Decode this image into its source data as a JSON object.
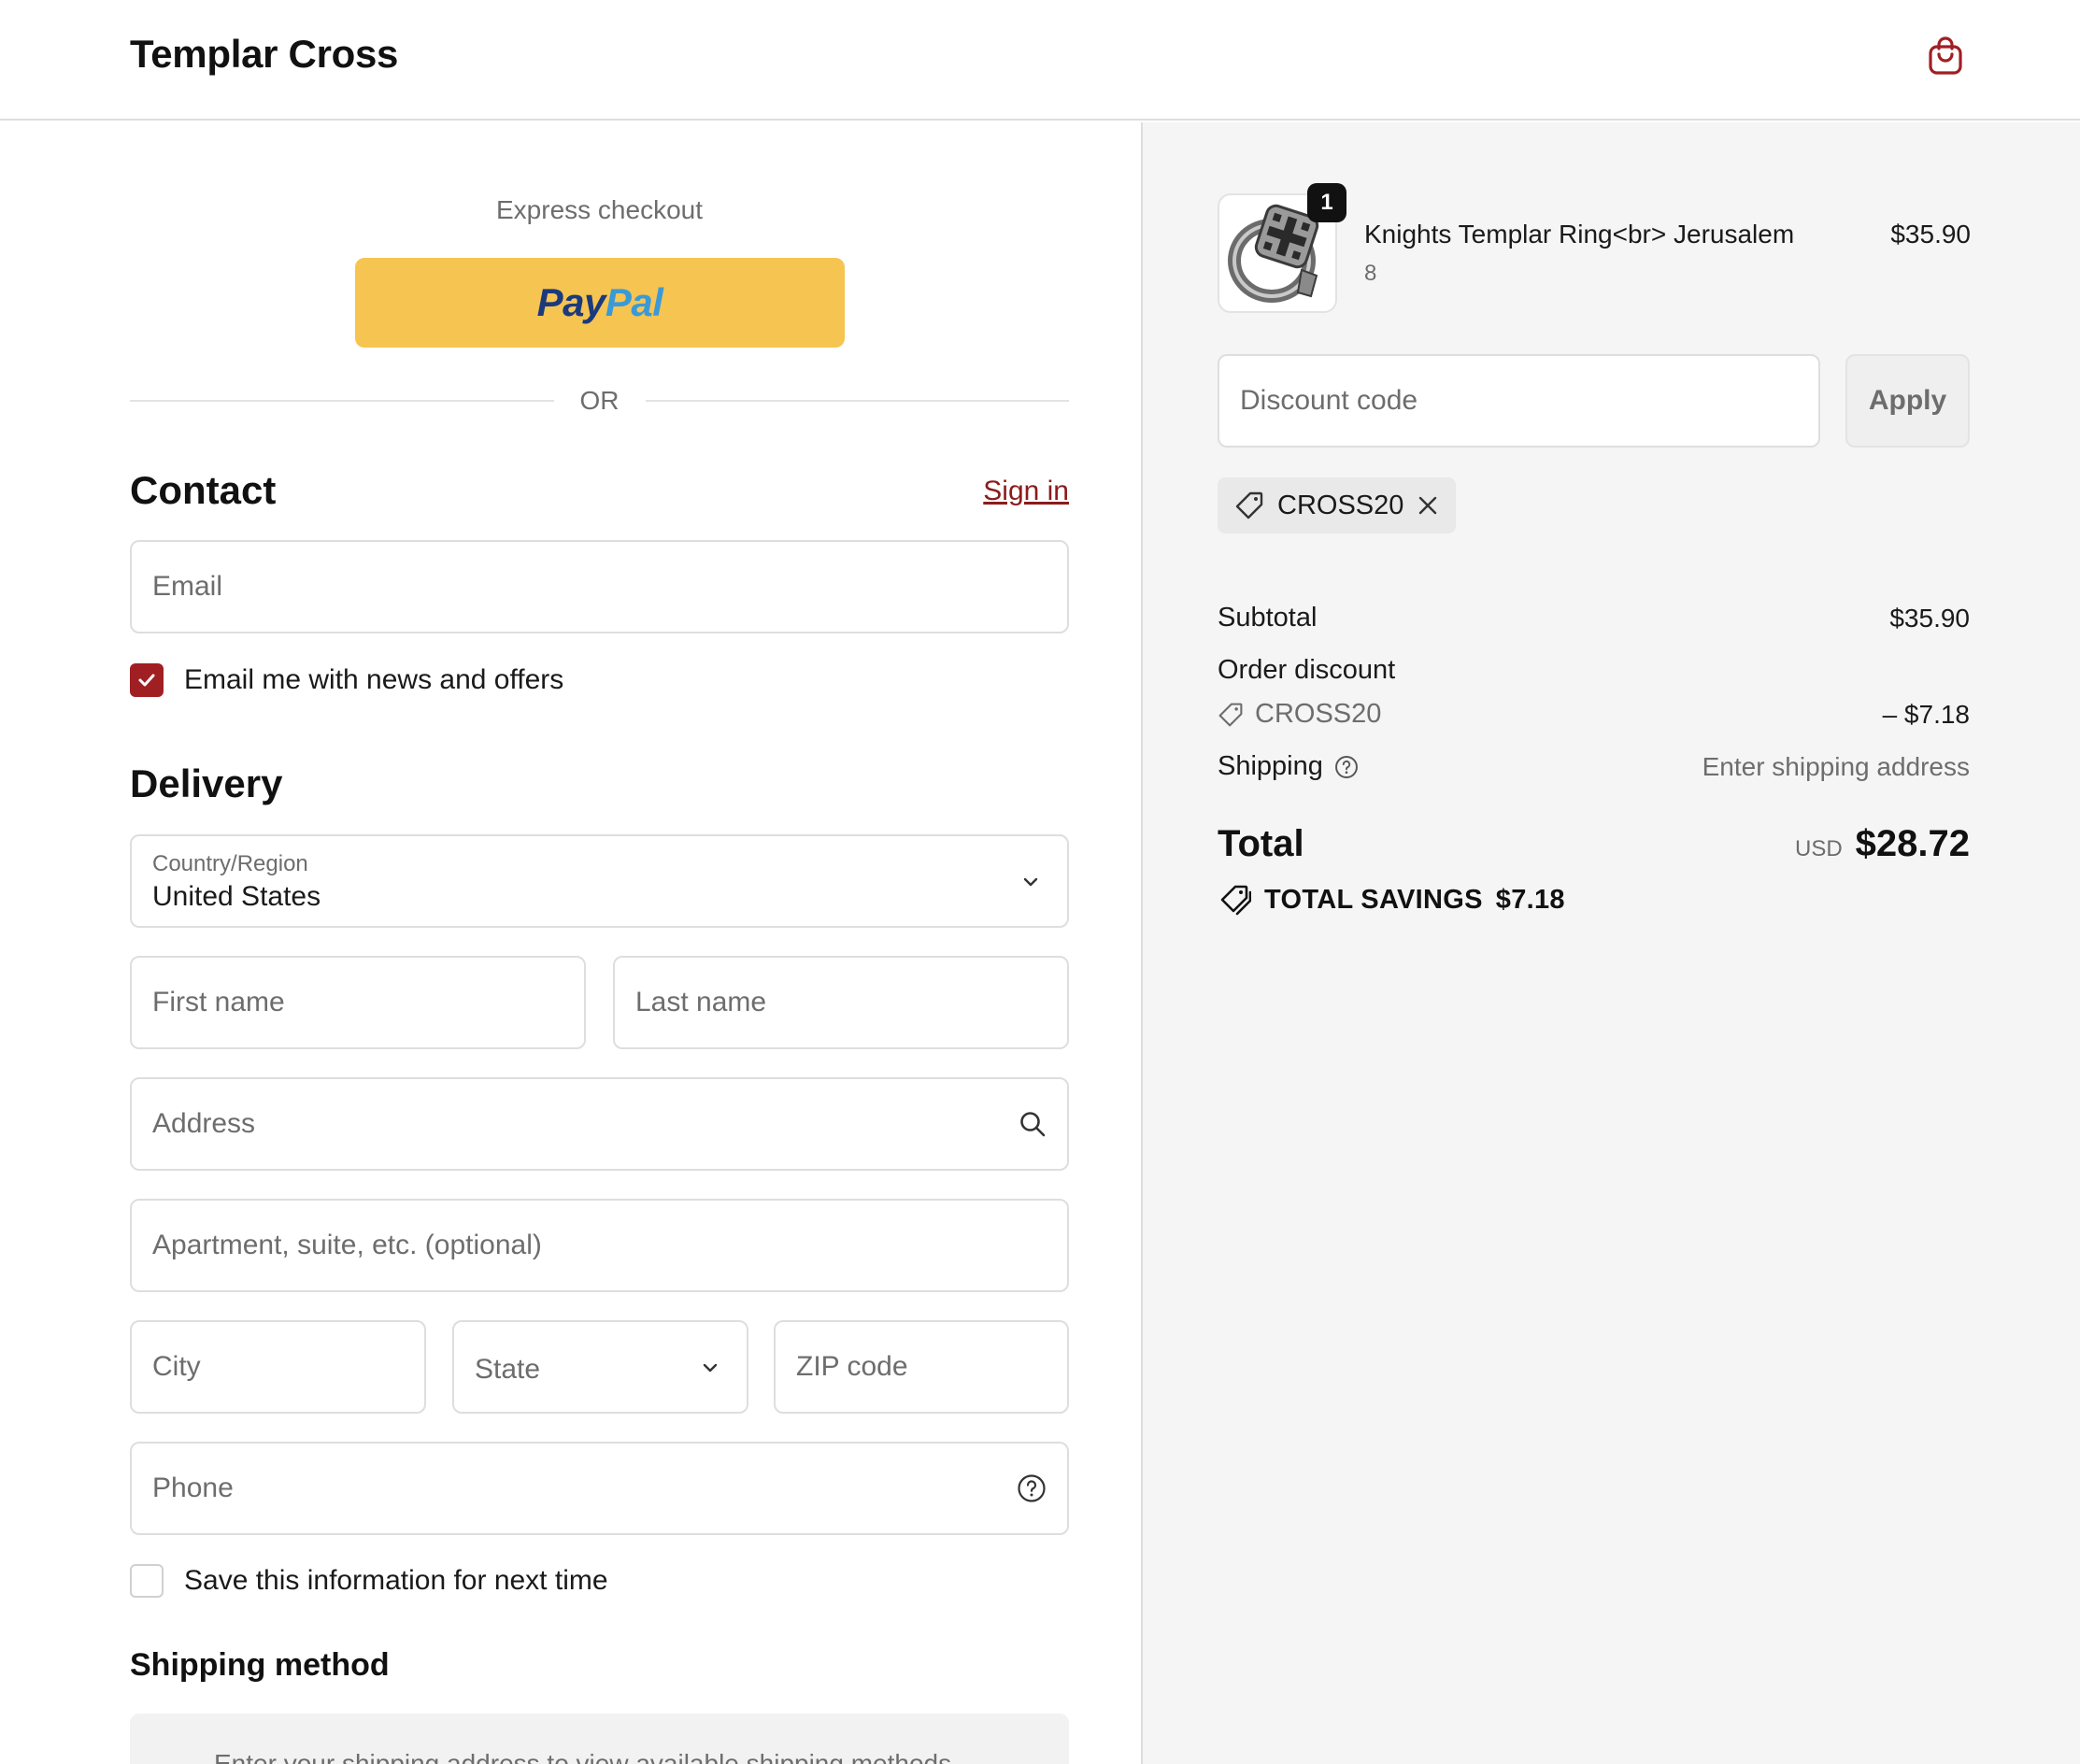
{
  "header": {
    "brand": "Templar Cross",
    "cart_icon": "shopping-bag-icon",
    "accent_color": "#a01f23"
  },
  "express": {
    "label": "Express checkout",
    "paypal_pay": "Pay",
    "paypal_pal": "Pal",
    "or_label": "OR"
  },
  "contact": {
    "title": "Contact",
    "signin_label": "Sign in",
    "email_placeholder": "Email",
    "newsletter_label": "Email me with news and offers",
    "newsletter_checked": true
  },
  "delivery": {
    "title": "Delivery",
    "country_label": "Country/Region",
    "country_value": "United States",
    "first_name_placeholder": "First name",
    "last_name_placeholder": "Last name",
    "address_placeholder": "Address",
    "apartment_placeholder": "Apartment, suite, etc. (optional)",
    "city_placeholder": "City",
    "state_label": "State",
    "zip_placeholder": "ZIP code",
    "phone_placeholder": "Phone",
    "save_info_label": "Save this information for next time",
    "save_info_checked": false
  },
  "shipping_method": {
    "title": "Shipping method",
    "message": "Enter your shipping address to view available shipping methods."
  },
  "summary": {
    "product": {
      "name": "Knights Templar Ring<br> Jerusalem",
      "variant": "8",
      "price": "$35.90",
      "quantity": "1"
    },
    "discount_placeholder": "Discount code",
    "apply_label": "Apply",
    "applied_code": "CROSS20",
    "subtotal_label": "Subtotal",
    "subtotal_value": "$35.90",
    "order_discount_label": "Order discount",
    "discount_code": "CROSS20",
    "discount_value": "– $7.18",
    "shipping_label": "Shipping",
    "shipping_value": "Enter shipping address",
    "total_label": "Total",
    "total_currency": "USD",
    "total_value": "$28.72",
    "savings_label": "TOTAL SAVINGS",
    "savings_value": "$7.18"
  }
}
